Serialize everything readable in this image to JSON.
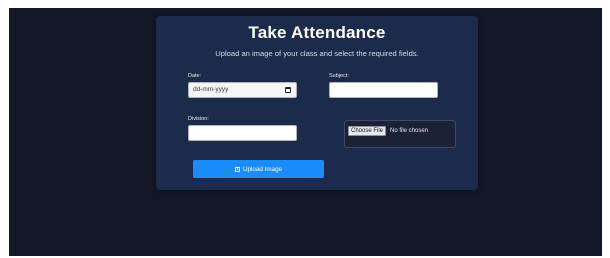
{
  "card": {
    "title": "Take Attendance",
    "subtitle": "Upload an image of your class and select the required fields."
  },
  "form": {
    "date_label": "Date:",
    "date_value": "dd-mm-yyyy",
    "subject_label": "Subject:",
    "subject_value": "",
    "division_label": "Division:",
    "division_value": "",
    "file_button_label": "Choose File",
    "file_status": "No file chosen",
    "upload_button_label": "Upload Image",
    "upload_icon": "upload-icon"
  },
  "colors": {
    "page_background": "#131826",
    "card_background": "#1c2a4b",
    "accent": "#1a8cff"
  }
}
